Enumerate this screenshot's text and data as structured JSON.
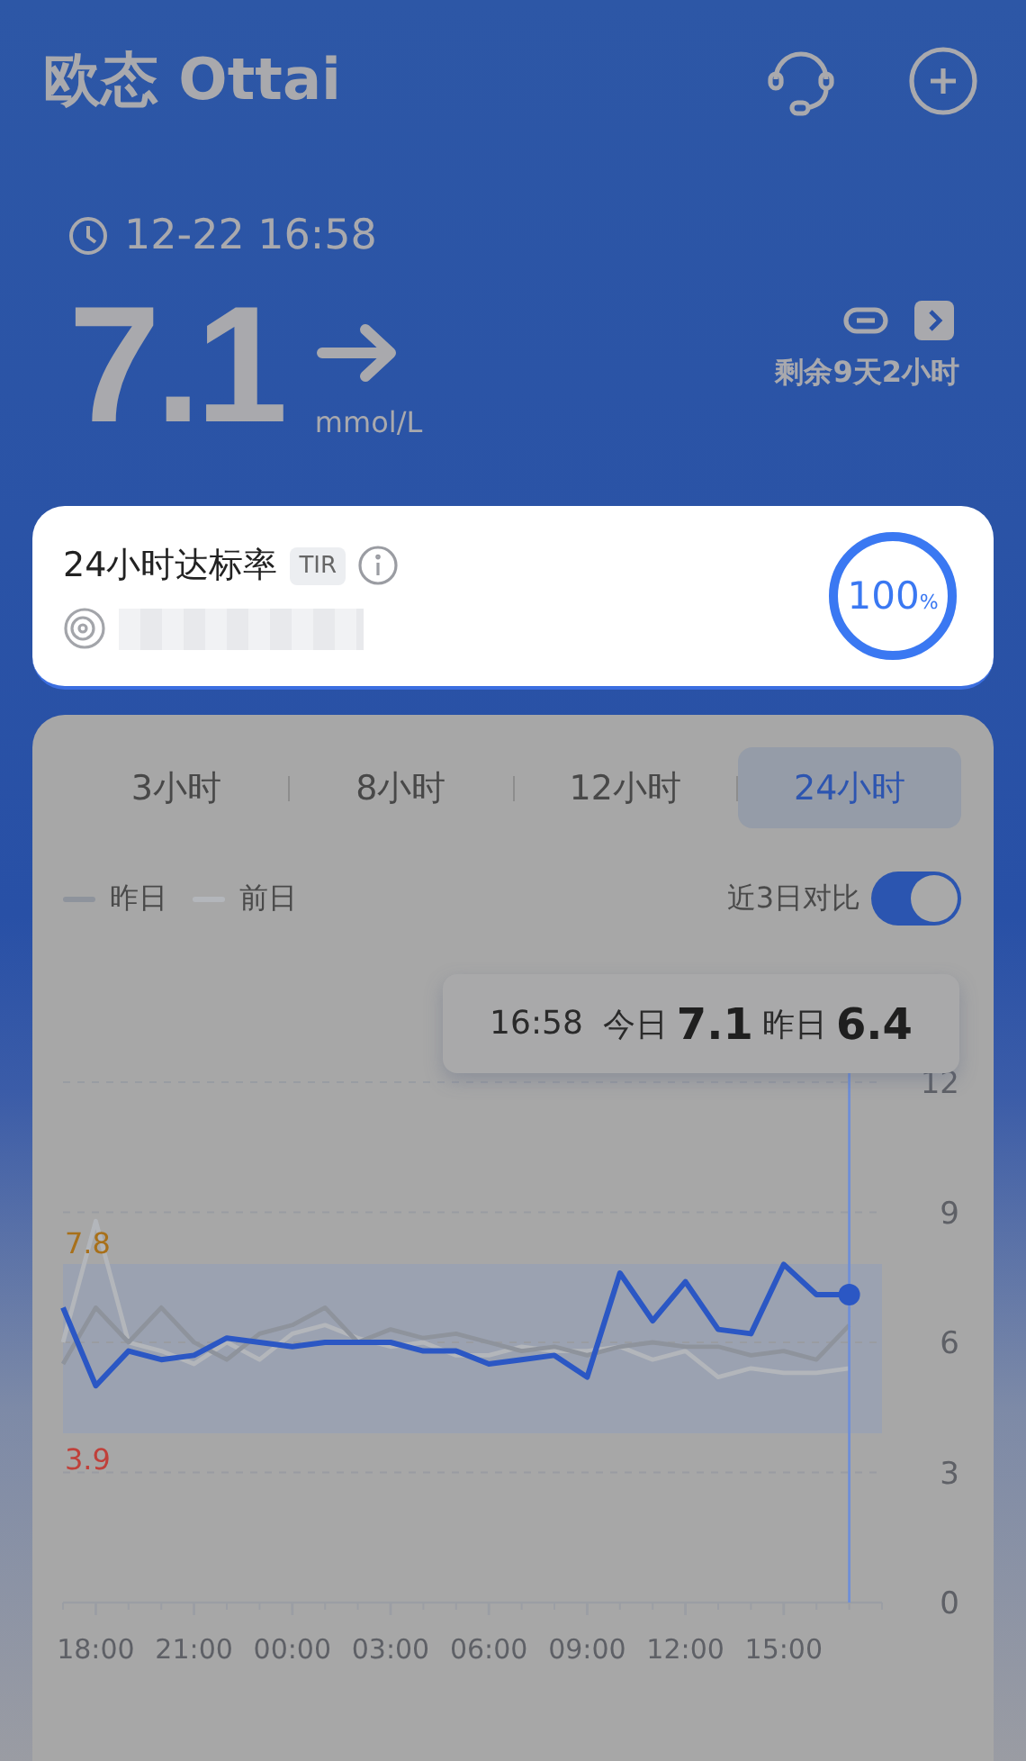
{
  "header": {
    "logo": "欧态 Ottai"
  },
  "reading": {
    "time": "12-22 16:58",
    "value": "7.1",
    "unit": "mmol/L",
    "remaining": "剩余9天2小时"
  },
  "tir_card": {
    "title": "24小时达标率",
    "badge": "TIR",
    "percent": "100",
    "percent_unit": "%",
    "level": 1.0
  },
  "tabs": [
    {
      "label": "3小时",
      "selected": false
    },
    {
      "label": "8小时",
      "selected": false
    },
    {
      "label": "12小时",
      "selected": false
    },
    {
      "label": "24小时",
      "selected": true
    }
  ],
  "compare_toggle": {
    "label": "近3日对比",
    "on": true
  },
  "tooltip": {
    "time": "16:58",
    "today_value": "7.1",
    "yesterday_value": "6.4"
  },
  "chart": {
    "target_range": {
      "high": "7.8",
      "low": "3.9"
    },
    "chart_data": {
      "type": "line",
      "categories": [
        null,
        "18:00",
        null,
        null,
        "21:00",
        null,
        null,
        "00:00",
        null,
        null,
        "03:00",
        null,
        null,
        "06:00",
        null,
        null,
        "09:00",
        null,
        null,
        "12:00",
        null,
        null,
        "15:00",
        null,
        null
      ],
      "series": [
        {
          "name": "今日",
          "color": "#2b57c4",
          "values": [
            6.8,
            5.0,
            5.8,
            5.6,
            5.7,
            6.1,
            6.0,
            5.9,
            6.0,
            6.0,
            6.0,
            5.8,
            5.8,
            5.5,
            5.6,
            5.7,
            5.2,
            7.6,
            6.5,
            7.4,
            6.3,
            6.2,
            7.8,
            7.1,
            7.1
          ]
        },
        {
          "name": "昨日",
          "color": "#8e939c",
          "values": [
            5.5,
            6.8,
            6.0,
            6.8,
            6.0,
            5.6,
            6.2,
            6.4,
            6.8,
            6.0,
            6.3,
            6.1,
            6.2,
            6.0,
            5.8,
            5.9,
            5.7,
            5.9,
            6.0,
            5.9,
            5.9,
            5.7,
            5.8,
            5.6,
            6.4
          ]
        },
        {
          "name": "前日",
          "color": "#b3b6bb",
          "values": [
            6.0,
            8.8,
            6.0,
            5.8,
            5.5,
            6.0,
            5.6,
            6.2,
            6.4,
            6.1,
            5.9,
            6.0,
            5.7,
            5.7,
            5.9,
            5.8,
            5.8,
            5.9,
            5.6,
            5.8,
            5.2,
            5.4,
            5.3,
            5.3,
            5.4
          ]
        }
      ],
      "ylim": [
        0,
        12
      ],
      "grid": true,
      "yticks": [
        0,
        3,
        6,
        9,
        12
      ]
    }
  }
}
